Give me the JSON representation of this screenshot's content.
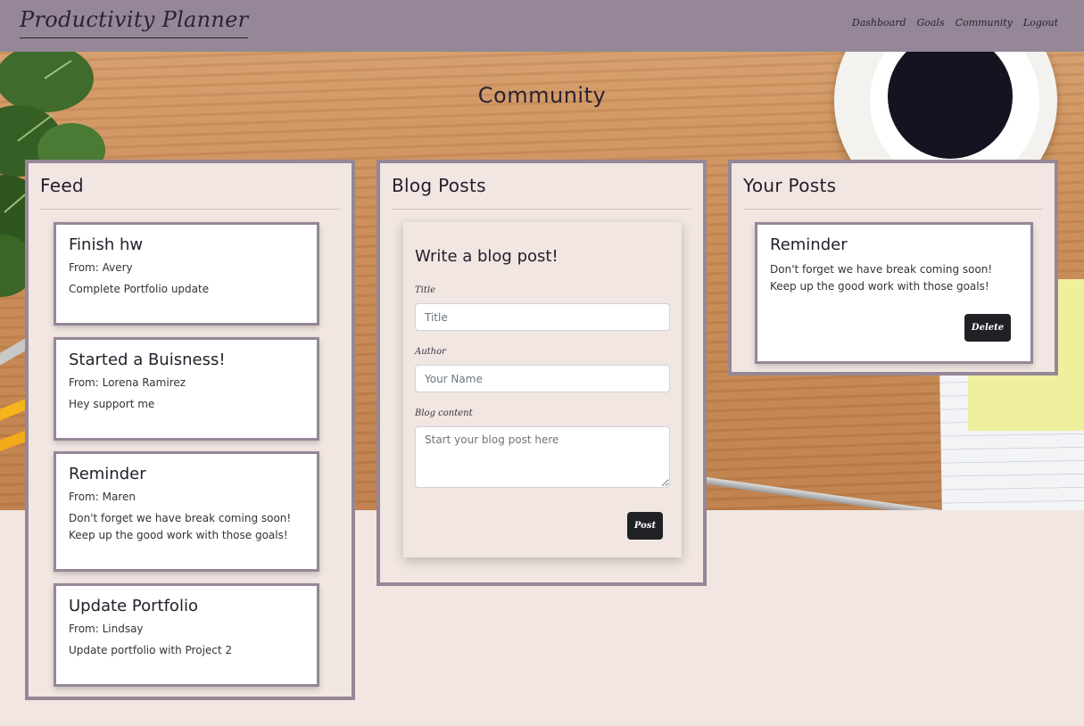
{
  "navbar": {
    "brand": "Productivity Planner",
    "links": [
      "Dashboard",
      "Goals",
      "Community",
      "Logout"
    ]
  },
  "page": {
    "title": "Community"
  },
  "feed": {
    "title": "Feed",
    "posts": [
      {
        "title": "Finish hw",
        "from": "From: Avery",
        "body": "Complete Portfolio update"
      },
      {
        "title": "Started a Buisness!",
        "from": "From: Lorena Ramirez",
        "body": "Hey support me"
      },
      {
        "title": "Reminder",
        "from": "From: Maren",
        "body": "Don't forget we have break coming soon! Keep up the good work with those goals!"
      },
      {
        "title": "Update Portfolio",
        "from": "From: Lindsay",
        "body": "Update portfolio with Project 2"
      }
    ]
  },
  "blog": {
    "title": "Blog Posts",
    "form": {
      "heading": "Write a blog post!",
      "title_label": "Title",
      "title_placeholder": "Title",
      "author_label": "Author",
      "author_placeholder": "Your Name",
      "content_label": "Blog content",
      "content_placeholder": "Start your blog post here",
      "submit_label": "Post"
    }
  },
  "your_posts": {
    "title": "Your Posts",
    "posts": [
      {
        "title": "Reminder",
        "body": "Don't forget we have break coming soon! Keep up the good work with those goals!",
        "delete_label": "Delete"
      }
    ]
  },
  "colors": {
    "navbar": "#958797",
    "page_background": "#f1e6e2",
    "button": "#1f2124"
  }
}
